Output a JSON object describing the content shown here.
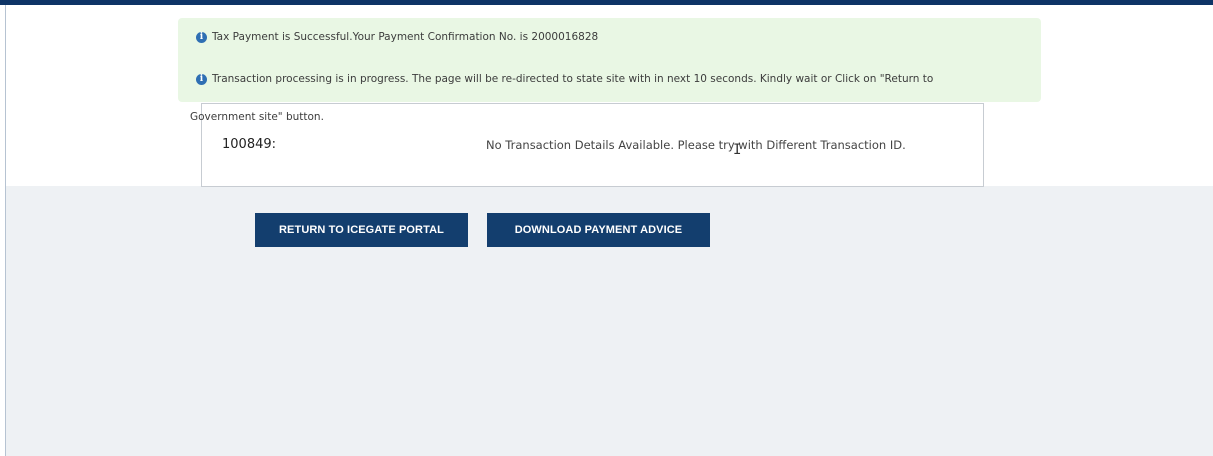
{
  "alerts": {
    "success": "Tax Payment is Successful.Your Payment Confirmation No. is 2000016828",
    "redirect_line1": "Transaction processing is in progress. The page will be re-directed to state site with in next 10 seconds. Kindly wait or Click on \"Return to",
    "redirect_line2": "Government site\" button."
  },
  "transaction": {
    "id": "100849:",
    "message": "No Transaction Details Available. Please try with Different Transaction ID."
  },
  "buttons": {
    "return_label": "RETURN TO ICEGATE PORTAL",
    "download_label": "DOWNLOAD PAYMENT ADVICE"
  },
  "icons": {
    "info": "info-icon",
    "cursor": "text-cursor-icon"
  },
  "colors": {
    "accent": "#0e3466",
    "button": "#133e6e",
    "alert_bg": "#e9f7e4",
    "info": "#2f6fb3"
  }
}
